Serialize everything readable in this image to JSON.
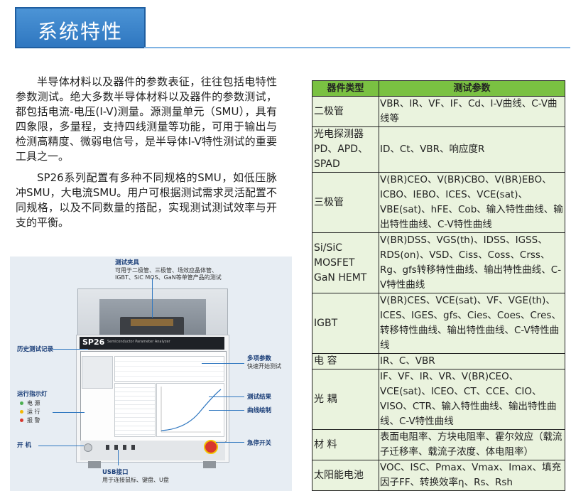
{
  "header": {
    "title": "系统特性"
  },
  "intro": {
    "paragraphs": [
      "半导体材料以及器件的参数表征，往往包括电特性参数测试。绝大多数半导体材料以及器件的参数测试，都包括电流-电压(I-V)测量。源测量单元（SMU），具有四象限，多量程，支持四线测量等功能，可用于输出与检测高精度、微弱电信号，是半导体I-V特性测试的重要工具之一。",
      "SP26系列配置有多种不同规格的SMU，如低压脉冲SMU，大电流SMU。用户可根据测试需求灵活配置不同规格，以及不同数量的搭配，实现测试测试效率与开支的平衡。"
    ]
  },
  "figure": {
    "brand": "SP26",
    "brand_sub": "Semiconductor Parameter Analyzer",
    "fixture_title": "测试夹具",
    "fixture_desc1": "可用于二极管、三极管、场效应晶体管、",
    "fixture_desc2": "IGBT、SiC MOS、GaN等单管产品的测试",
    "history": "历史测试记录",
    "indicator_title": "运行指示灯",
    "indicators": [
      {
        "label": "电 源",
        "color": "#4caf50"
      },
      {
        "label": "运 行",
        "color": "#f2b705"
      },
      {
        "label": "报 警",
        "color": "#d8372e"
      }
    ],
    "power": "开 机",
    "params_title": "多项参数",
    "params_desc": "快速开始测试",
    "results": "测试结果",
    "curve": "曲线绘制",
    "estop": "急停开关",
    "usb_title": "USB接口",
    "usb_desc": "用于连接鼠标、键盘、U盘"
  },
  "table": {
    "headers": [
      "器件类型",
      "测试参数"
    ],
    "rows": [
      {
        "type": "二极管",
        "params": "VBR、IR、VF、IF、Cd、I-V曲线、C-V曲线等"
      },
      {
        "type": "光电探测器 PD、APD、SPAD",
        "params": "ID、Ct、VBR、响应度R"
      },
      {
        "type": "三极管",
        "params": "V(BR)CEO、V(BR)CBO、V(BR)EBO、ICBO、IEBO、ICES、VCE(sat)、VBE(sat)、hFE、Cob、输入特性曲线、输出特性曲线、C-V特性曲线"
      },
      {
        "type": "Si/SiC MOSFET GaN HEMT",
        "params": "V(BR)DSS、VGS(th)、IDSS、IGSS、RDS(on)、VSD、Ciss、Coss、Crss、Rg、gfs转移特性曲线、输出特性曲线、C-V特性曲线"
      },
      {
        "type": "IGBT",
        "params": "V(BR)CES、VCE(sat)、VF、VGE(th)、ICES、IGES、gfs、Cies、Coes、Cres、转移特性曲线、输出特性曲线、C-V特性曲线"
      },
      {
        "type": "电 容",
        "params": "IR、C、VBR"
      },
      {
        "type": "光 耦",
        "params": "IF、VF、IR、VR、V(BR)CEO、VCE(sat)、ICEO、CT、CCE、CIO、VISO、CTR、输入特性曲线、输出特性曲线、C-V特性曲线"
      },
      {
        "type": "材 料",
        "params": "表面电阻率、方块电阻率、霍尔效应（载流子迁移率、载流子浓度、体电阻率）"
      },
      {
        "type": "太阳能电池",
        "params": "VOC、ISC、Pmax、Vmax、Imax、填充因子FF、转换效率η、Rs、Rsh"
      }
    ]
  }
}
